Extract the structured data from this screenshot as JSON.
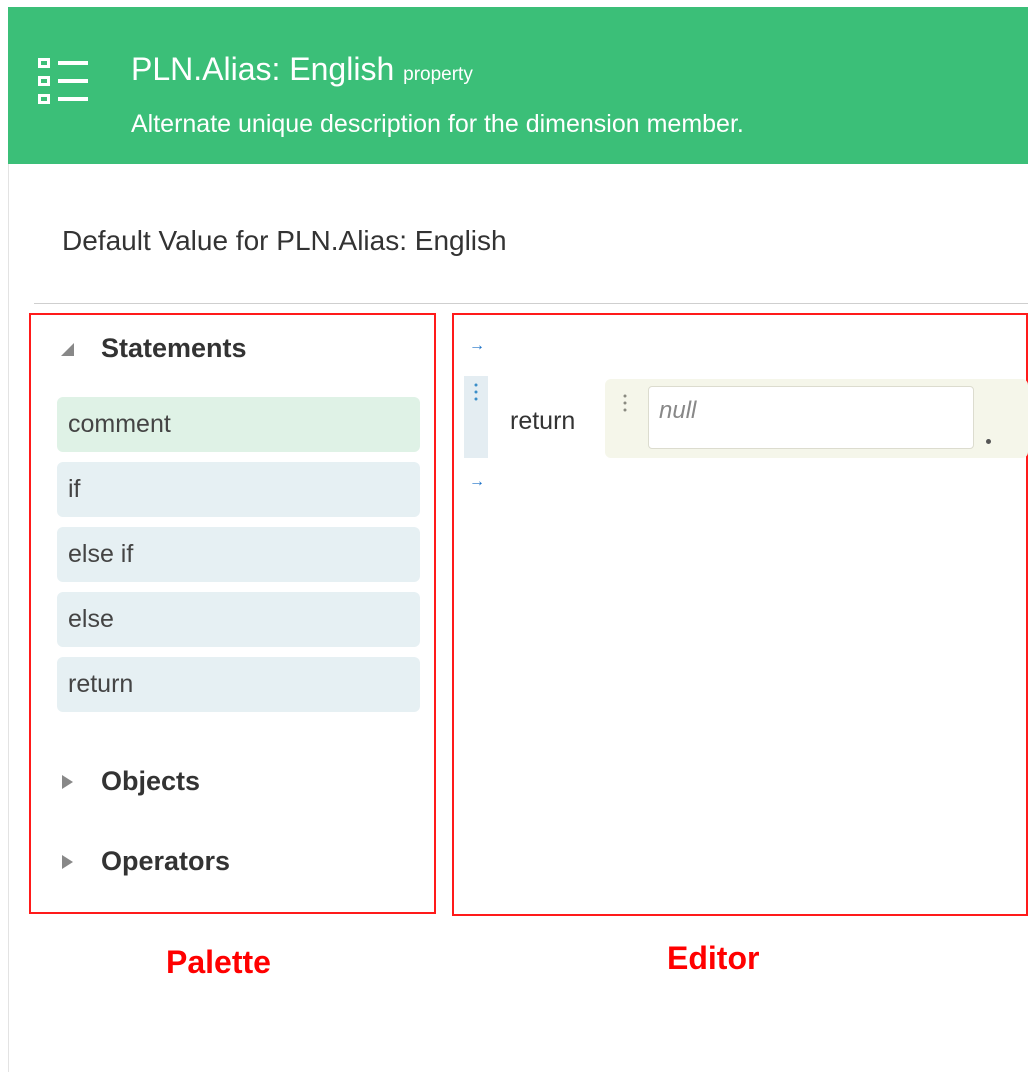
{
  "header": {
    "icon": "list-icon",
    "title": "PLN.Alias: English",
    "title_suffix": "property",
    "description": "Alternate unique description for the dimension member."
  },
  "section": {
    "title": "Default Value for PLN.Alias: English"
  },
  "palette": {
    "categories": [
      {
        "label": "Statements",
        "expanded": true,
        "items": [
          "comment",
          "if",
          "else if",
          "else",
          "return"
        ],
        "selected_item": "comment"
      },
      {
        "label": "Objects",
        "expanded": false
      },
      {
        "label": "Operators",
        "expanded": false
      }
    ]
  },
  "editor": {
    "statement_keyword": "return",
    "expression_placeholder": "null"
  },
  "annotations": {
    "palette": "Palette",
    "editor": "Editor"
  },
  "colors": {
    "header_bg": "#3bbf78",
    "annotation": "#ff0000",
    "palette_item_bg": "#e6f0f3",
    "palette_item_active_bg": "#dff2e6",
    "expression_bg": "#f5f6ea",
    "insert_arrow": "#1e73c8"
  }
}
